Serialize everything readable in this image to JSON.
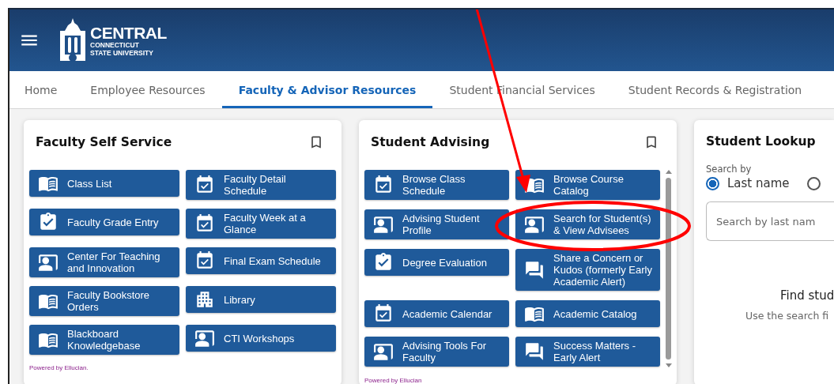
{
  "header": {
    "logo": {
      "name": "CENTRAL",
      "line_1": "CONNECTICUT",
      "line_2": "STATE UNIVERSITY"
    }
  },
  "tabs": [
    {
      "label": "Home",
      "selected": false
    },
    {
      "label": "Employee Resources",
      "selected": false
    },
    {
      "label": "Faculty & Advisor Resources",
      "selected": true
    },
    {
      "label": "Student Financial Services",
      "selected": false
    },
    {
      "label": "Student Records & Registration",
      "selected": false
    }
  ],
  "cards": [
    {
      "title": "Faculty Self Service",
      "scrollbar": false,
      "footer": "Powered by Ellucian.",
      "buttons": [
        {
          "label": "Class List",
          "kind": "book"
        },
        {
          "label": "Faculty Detail Schedule",
          "kind": "calendar"
        },
        {
          "label": "Faculty Grade Entry",
          "kind": "clipboard"
        },
        {
          "label": "Faculty Week at a Glance",
          "kind": "calendar"
        },
        {
          "label": "Center For Teaching and Innovation",
          "kind": "presenter"
        },
        {
          "label": "Final Exam Schedule",
          "kind": "calendar"
        },
        {
          "label": "Faculty Bookstore Orders",
          "kind": "book"
        },
        {
          "label": "Library",
          "kind": "building"
        },
        {
          "label": "Blackboard Knowledgebase",
          "kind": "book"
        },
        {
          "label": "CTI Workshops",
          "kind": "presenter"
        }
      ]
    },
    {
      "title": "Student Advising",
      "scrollbar": true,
      "footer": "Powered by Ellucian",
      "buttons": [
        {
          "label": "Browse Class Schedule",
          "kind": "calendar"
        },
        {
          "label": "Browse Course Catalog",
          "kind": "book"
        },
        {
          "label": "Advising Student Profile",
          "kind": "presenter"
        },
        {
          "label": "Search for Student(s) & View Advisees",
          "kind": "presenter"
        },
        {
          "label": "Degree Evaluation",
          "kind": "clipboard"
        },
        {
          "label": "Share a Concern or Kudos (formerly Early Academic Alert)",
          "kind": "chat"
        },
        {
          "label": "Academic Calendar",
          "kind": "calendar"
        },
        {
          "label": "Academic Catalog",
          "kind": "book"
        },
        {
          "label": "Advising Tools For Faculty",
          "kind": "presenter"
        },
        {
          "label": "Success Matters - Early Alert",
          "kind": "chat"
        }
      ]
    }
  ],
  "lookup": {
    "title": "Student Lookup",
    "search_by_label": "Search by",
    "options": [
      {
        "label": "Last name",
        "selected": true
      },
      {
        "selected": false
      }
    ],
    "search": {
      "placeholder": "Search by last nam"
    },
    "empty_title": "Find stud",
    "empty_hint": "Use the search fi"
  }
}
